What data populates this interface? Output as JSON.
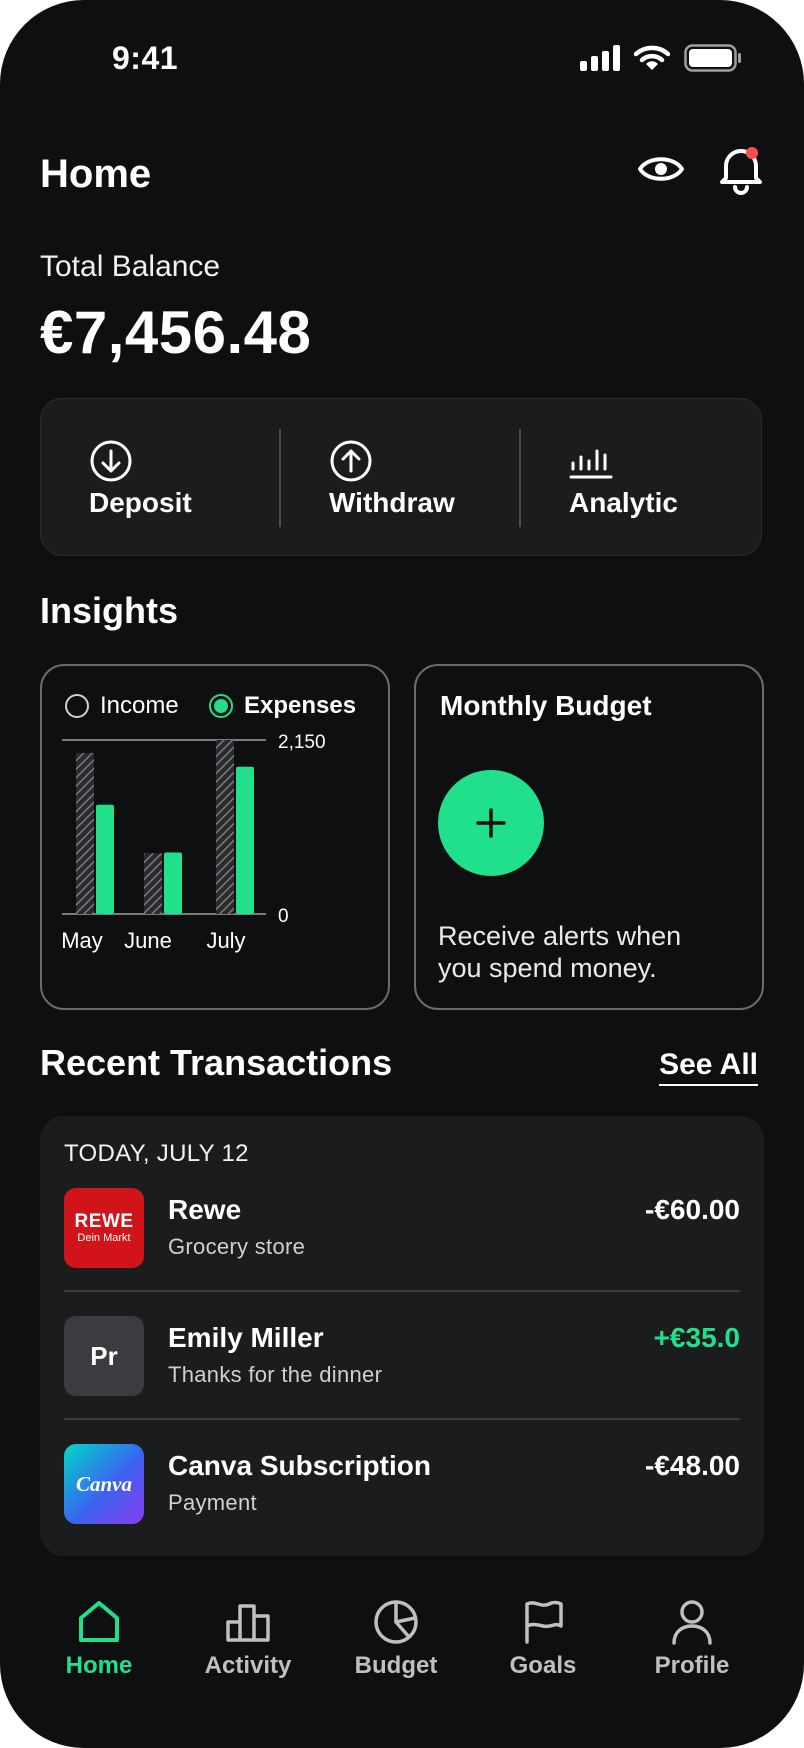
{
  "status_bar": {
    "time": "9:41"
  },
  "header": {
    "title": "Home",
    "eye_icon": "eye-icon",
    "bell_icon": "bell-icon",
    "notification_dot_color": "#ff4d4f"
  },
  "balance": {
    "label": "Total Balance",
    "value": "€7,456.48"
  },
  "actions": [
    {
      "label": "Deposit",
      "icon": "arrow-down-circle-icon"
    },
    {
      "label": "Withdraw",
      "icon": "arrow-up-circle-icon"
    },
    {
      "label": "Analytic",
      "icon": "analytics-bars-icon"
    }
  ],
  "insights": {
    "title": "Insights",
    "legend": {
      "income": "Income",
      "expenses": "Expenses"
    },
    "budget": {
      "title": "Monthly Budget",
      "text_line1": "Receive alerts when",
      "text_line2": "you spend money."
    }
  },
  "chart_data": {
    "type": "bar",
    "categories": [
      "May",
      "June",
      "July"
    ],
    "series": [
      {
        "name": "Income",
        "values": [
          1990,
          750,
          2150
        ]
      },
      {
        "name": "Expenses",
        "values": [
          1350,
          760,
          1820
        ]
      }
    ],
    "y_ticks": [
      "2,150",
      "0"
    ],
    "ylim": [
      0,
      2150
    ],
    "legend_position": "top",
    "colors": {
      "income": "#8a8a8a",
      "expenses": "#21e08b"
    }
  },
  "transactions": {
    "title": "Recent Transactions",
    "see_all": "See All",
    "date_label": "TODAY, JULY 12",
    "items": [
      {
        "name": "Rewe",
        "sub": "Grocery store",
        "amount": "-€60.00",
        "logo_text1": "REWE",
        "logo_text2": "Dein Markt",
        "amount_color": "#ffffff"
      },
      {
        "name": "Emily Miller",
        "sub": "Thanks for the dinner",
        "amount": "+€35.0",
        "logo_text1": "Pr",
        "amount_color": "#21e08b"
      },
      {
        "name": "Canva Subscription",
        "sub": "Payment",
        "amount": "-€48.00",
        "logo_text1": "Canva",
        "amount_color": "#ffffff"
      }
    ]
  },
  "nav": [
    {
      "label": "Home",
      "icon": "home-icon",
      "active": true
    },
    {
      "label": "Activity",
      "icon": "activity-bars-icon"
    },
    {
      "label": "Budget",
      "icon": "pie-chart-icon"
    },
    {
      "label": "Goals",
      "icon": "flag-icon"
    },
    {
      "label": "Profile",
      "icon": "user-icon"
    }
  ],
  "colors": {
    "accent": "#21e08b",
    "background": "#0e0f11",
    "card": "#1b1c1e"
  }
}
